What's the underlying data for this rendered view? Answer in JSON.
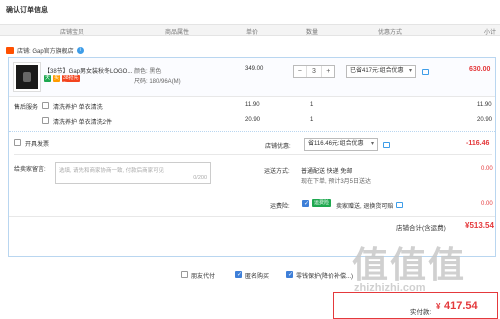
{
  "page": {
    "title": "确认订单信息"
  },
  "columns": {
    "store": "店铺宝贝",
    "attr": "商品属性",
    "price": "单价",
    "qty": "数量",
    "discount": "优惠方式",
    "subtotal": "小计"
  },
  "store": {
    "label": "店铺: Gap官方旗舰店",
    "info_icon": "info-icon"
  },
  "product": {
    "name": "【38节】Gap男女装秋冬LOGO...",
    "tags": [
      "天",
      "买",
      "38抢先购"
    ],
    "color": "颜色: 黑色",
    "size": "尺码: 180/96A(M)",
    "unit_price": "349.00",
    "qty": "3",
    "minus": "−",
    "plus": "+",
    "discount": "已省417元:组合优惠",
    "subtotal": "630.00"
  },
  "services": {
    "label": "售后服务",
    "items": [
      {
        "name": "清洗养护 单衣清洗",
        "price": "11.90",
        "qty": "1",
        "total": "11.90",
        "checked": false
      },
      {
        "name": "清洗养护 单衣清洗2件",
        "price": "20.90",
        "qty": "1",
        "total": "20.90",
        "checked": false
      }
    ]
  },
  "invoice": {
    "label": "开具发票"
  },
  "shop_discount": {
    "label": "店铺优惠:",
    "value": "省116.46元:组合优惠",
    "amount": "-116.46"
  },
  "message": {
    "label": "给卖家留言:",
    "placeholder": "选填, 请先和商家协商一致, 付款后商家可见",
    "counter": "0/200"
  },
  "shipping": {
    "label": "运送方式:",
    "method": "普通配送 快递 免邮",
    "note": "现在下单, 预计3月5日送达",
    "fee": "0.00"
  },
  "insurance": {
    "label": "运费险:",
    "badge": "运费险",
    "text": "卖家赠送, 退换货可赔",
    "fee": "0.00"
  },
  "store_total": {
    "label": "店铺合计(含运费)",
    "value": "¥513.54"
  },
  "options": {
    "friend_pay": "朋友代付",
    "anonymous": "匿名购买",
    "protection": "零钱保护(降价补偿...)"
  },
  "payment": {
    "label": "实付款:",
    "currency": "¥",
    "amount": "417.54"
  },
  "watermark": {
    "big": "值值值",
    "url": "zhizhizhi.com"
  },
  "colors": {
    "accent": "#e4393c",
    "border": "#b9d6f0",
    "brand": "#ff5000"
  }
}
